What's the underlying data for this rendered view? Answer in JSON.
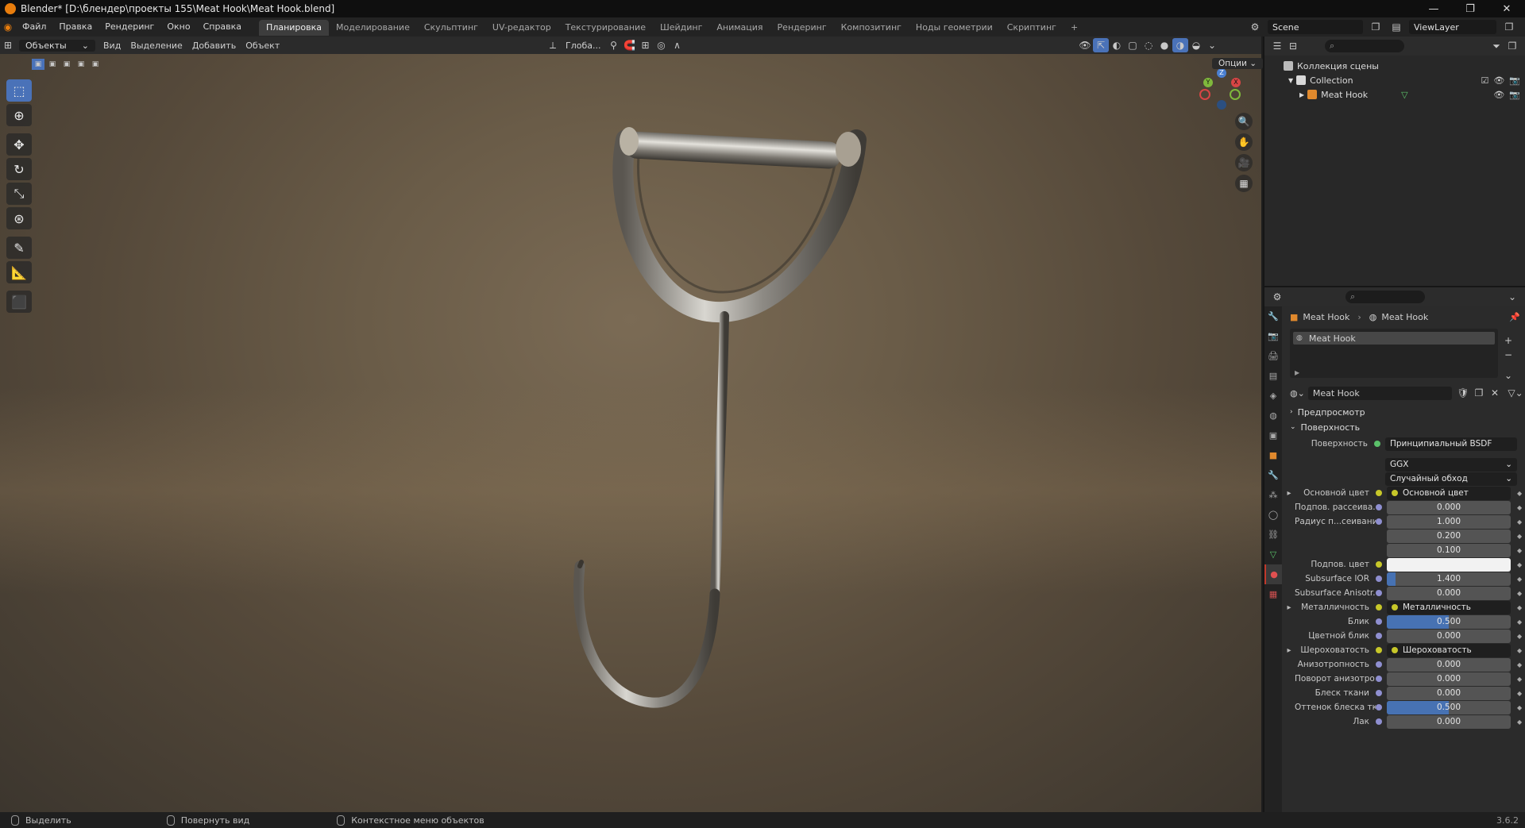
{
  "window": {
    "title": "Blender* [D:\\блендер\\проекты 155\\Meat Hook\\Meat Hook.blend]",
    "controls": [
      "—",
      "❐",
      "✕"
    ]
  },
  "menu": {
    "items": [
      "Файл",
      "Правка",
      "Рендеринг",
      "Окно",
      "Справка"
    ],
    "workspaces": [
      "Планировка",
      "Моделирование",
      "Скульптинг",
      "UV-редактор",
      "Текстурирование",
      "Шейдинг",
      "Анимация",
      "Рендеринг",
      "Композитинг",
      "Ноды геометрии",
      "Скриптинг",
      "+"
    ],
    "active_workspace": "Планировка",
    "scene": "Scene",
    "view_layer": "ViewLayer"
  },
  "viewport_header": {
    "mode": "Объекты",
    "menus": [
      "Вид",
      "Выделение",
      "Добавить",
      "Объект"
    ],
    "orientation": "Глоба...",
    "options": "Опции"
  },
  "toolbar": {
    "tools": [
      "select-box",
      "cursor",
      "move",
      "rotate",
      "scale",
      "transform",
      "annotate",
      "measure",
      "add-cube"
    ],
    "active": "select-box"
  },
  "gizmo": {
    "x": "X",
    "y": "Y",
    "z": "Z"
  },
  "outliner": {
    "rows": [
      {
        "label": "Коллекция сцены",
        "indent": 0
      },
      {
        "label": "Collection",
        "indent": 1
      },
      {
        "label": "Meat Hook",
        "indent": 2
      }
    ]
  },
  "properties": {
    "breadcrumb": [
      "Meat Hook",
      "Meat Hook"
    ],
    "slot_name": "Meat Hook",
    "material_name": "Meat Hook",
    "sections": {
      "preview": "Предпросмотр",
      "surface": "Поверхность"
    },
    "surface_label": "Поверхность",
    "surface_value": "Принципиальный BSDF",
    "distribution": "GGX",
    "subsurface_method": "Случайный обход",
    "rows": [
      {
        "label": "Основной цвет",
        "value": "Основной цвет",
        "type": "link",
        "expand": true
      },
      {
        "label": "Подпов. рассеива...",
        "value": "0.000",
        "type": "num"
      },
      {
        "label": "Радиус п...сеивания",
        "value": "1.000",
        "type": "num"
      },
      {
        "label": "",
        "value": "0.200",
        "type": "num"
      },
      {
        "label": "",
        "value": "0.100",
        "type": "num"
      },
      {
        "label": "Подпов. цвет",
        "value": "",
        "type": "color"
      },
      {
        "label": "Subsurface IOR",
        "value": "1.400",
        "type": "num",
        "fill": 0.07
      },
      {
        "label": "Subsurface Anisotr...",
        "value": "0.000",
        "type": "num"
      },
      {
        "label": "Металличность",
        "value": "Металличность",
        "type": "link",
        "expand": true
      },
      {
        "label": "Блик",
        "value": "0.500",
        "type": "num",
        "fill": 0.5
      },
      {
        "label": "Цветной блик",
        "value": "0.000",
        "type": "num"
      },
      {
        "label": "Шероховатость",
        "value": "Шероховатость",
        "type": "link",
        "expand": true
      },
      {
        "label": "Анизотропность",
        "value": "0.000",
        "type": "num"
      },
      {
        "label": "Поворот анизотро...",
        "value": "0.000",
        "type": "num"
      },
      {
        "label": "Блеск ткани",
        "value": "0.000",
        "type": "num"
      },
      {
        "label": "Оттенок блеска тк...",
        "value": "0.500",
        "type": "num",
        "fill": 0.5
      },
      {
        "label": "Лак",
        "value": "0.000",
        "type": "num"
      }
    ]
  },
  "statusbar": {
    "items": [
      "Выделить",
      "Повернуть вид",
      "Контекстное меню объектов"
    ],
    "version": "3.6.2"
  }
}
